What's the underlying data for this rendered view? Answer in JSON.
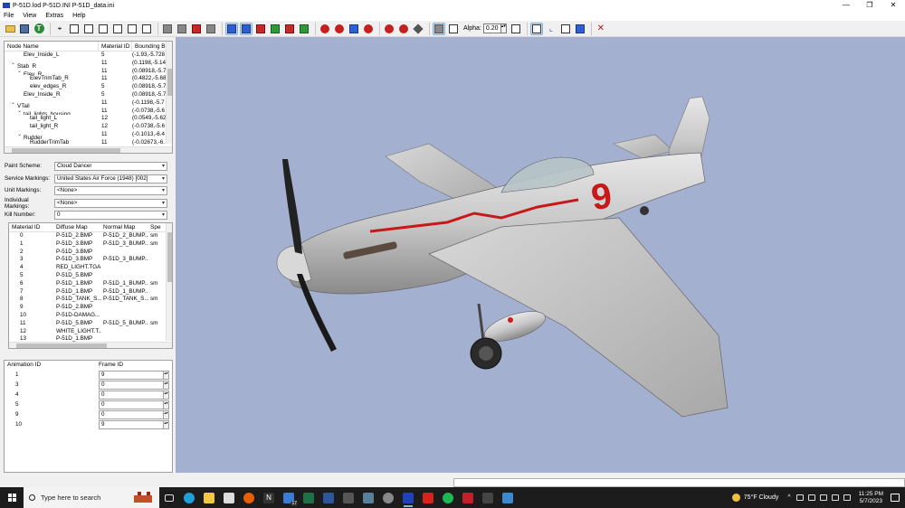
{
  "window": {
    "title": "P-51D.lod  P-51D.INI  P-51D_data.ini",
    "controls": [
      "—",
      "❐",
      "✕"
    ]
  },
  "menu": [
    "File",
    "View",
    "Extras",
    "Help"
  ],
  "toolbar": {
    "alpha_label": "Alpha:",
    "alpha_value": "0.20"
  },
  "tree": {
    "headers": [
      "Node Name",
      "Material ID",
      "Bounding B"
    ],
    "rows": [
      {
        "indent": 4,
        "expander": "",
        "name": "Elev_Inside_L",
        "mat": "5",
        "bb": "(-1.93,-5.728"
      },
      {
        "indent": 3,
        "expander": "v",
        "name": "Stab_R",
        "mat": "11",
        "bb": "(0.1198,-5.14"
      },
      {
        "indent": 4,
        "expander": "v",
        "name": "Elev_R",
        "mat": "11",
        "bb": "(0.08918,-5.7"
      },
      {
        "indent": 5,
        "expander": "",
        "name": "ElevTrimTab_R",
        "mat": "11",
        "bb": "(0.4822,-5.68"
      },
      {
        "indent": 5,
        "expander": "",
        "name": "elev_edges_R",
        "mat": "5",
        "bb": "(0.08918,-5.7"
      },
      {
        "indent": 4,
        "expander": "",
        "name": "Elev_Inside_R",
        "mat": "5",
        "bb": "(0.08918,-5.7"
      },
      {
        "indent": 3,
        "expander": "v",
        "name": "VTail",
        "mat": "11",
        "bb": "(-0.1198,-5.7"
      },
      {
        "indent": 4,
        "expander": "v",
        "name": "tail_lights_housing",
        "mat": "11",
        "bb": "(-0.0738,-5.6"
      },
      {
        "indent": 5,
        "expander": "",
        "name": "tail_light_L",
        "mat": "12",
        "bb": "(0.0549,-5.62"
      },
      {
        "indent": 5,
        "expander": "",
        "name": "tail_light_R",
        "mat": "12",
        "bb": "(-0.0738,-5.6"
      },
      {
        "indent": 4,
        "expander": "v",
        "name": "Rudder",
        "mat": "11",
        "bb": "(-0.1013,-6.4"
      },
      {
        "indent": 5,
        "expander": "",
        "name": "RudderTrimTab",
        "mat": "11",
        "bb": "(-0.02673,-6."
      }
    ]
  },
  "form": {
    "paint_scheme": {
      "label": "Paint Scheme:",
      "value": "Cloud Dancer"
    },
    "service_markings": {
      "label": "Service Markings:",
      "value": "United States Air Force (1948) [002]"
    },
    "unit_markings": {
      "label": "Unit Markings:",
      "value": "<None>"
    },
    "individual_markings": {
      "label": "Individual Markings:",
      "value": "<None>"
    },
    "kill_number": {
      "label": "Kill Number:",
      "value": "0"
    }
  },
  "materials": {
    "headers": [
      "Material ID",
      "Diffuse Map",
      "Normal Map",
      "Spe"
    ],
    "rows": [
      {
        "id": "0",
        "diffuse": "P-51D_2.BMP",
        "normal": "P-51D_2_BUMP....",
        "spec": "sm"
      },
      {
        "id": "1",
        "diffuse": "P-51D_3.BMP",
        "normal": "P-51D_3_BUMP....",
        "spec": "sm"
      },
      {
        "id": "2",
        "diffuse": "P-51D_3.BMP",
        "normal": "",
        "spec": ""
      },
      {
        "id": "3",
        "diffuse": "P-51D_3.BMP",
        "normal": "P-51D_3_BUMP....",
        "spec": ""
      },
      {
        "id": "4",
        "diffuse": "RED_LIGHT.TGA",
        "normal": "",
        "spec": ""
      },
      {
        "id": "5",
        "diffuse": "P-51D_5.BMP",
        "normal": "",
        "spec": ""
      },
      {
        "id": "6",
        "diffuse": "P-51D_1.BMP",
        "normal": "P-51D_1_BUMP....",
        "spec": "sm"
      },
      {
        "id": "7",
        "diffuse": "P-51D_1.BMP",
        "normal": "P-51D_1_BUMP....",
        "spec": ""
      },
      {
        "id": "8",
        "diffuse": "P-51D_TANK_S...",
        "normal": "P-51D_TANK_S...",
        "spec": "sm"
      },
      {
        "id": "9",
        "diffuse": "P-51D_2.BMP",
        "normal": "",
        "spec": ""
      },
      {
        "id": "10",
        "diffuse": "P-51D-DAMAG...",
        "normal": "",
        "spec": ""
      },
      {
        "id": "11",
        "diffuse": "P-51D_5.BMP",
        "normal": "P-51D_5_BUMP....",
        "spec": "sm"
      },
      {
        "id": "12",
        "diffuse": "WHITE_LIGHT.T...",
        "normal": "",
        "spec": ""
      },
      {
        "id": "13",
        "diffuse": "P-51D_1.BMP",
        "normal": "",
        "spec": ""
      }
    ]
  },
  "animation": {
    "headers": [
      "Animation ID",
      "Frame ID"
    ],
    "rows": [
      {
        "id": "1",
        "frame": "9"
      },
      {
        "id": "3",
        "frame": "0"
      },
      {
        "id": "4",
        "frame": "0"
      },
      {
        "id": "5",
        "frame": "0"
      },
      {
        "id": "9",
        "frame": "0"
      },
      {
        "id": "10",
        "frame": "9"
      }
    ]
  },
  "viewport": {
    "background": "#a3b0d0",
    "aircraft_number": "9"
  },
  "taskbar": {
    "search_placeholder": "Type here to search",
    "weather": "75°F  Cloudy",
    "time": "11:25 PM",
    "date": "5/7/2023",
    "badge": "17"
  }
}
